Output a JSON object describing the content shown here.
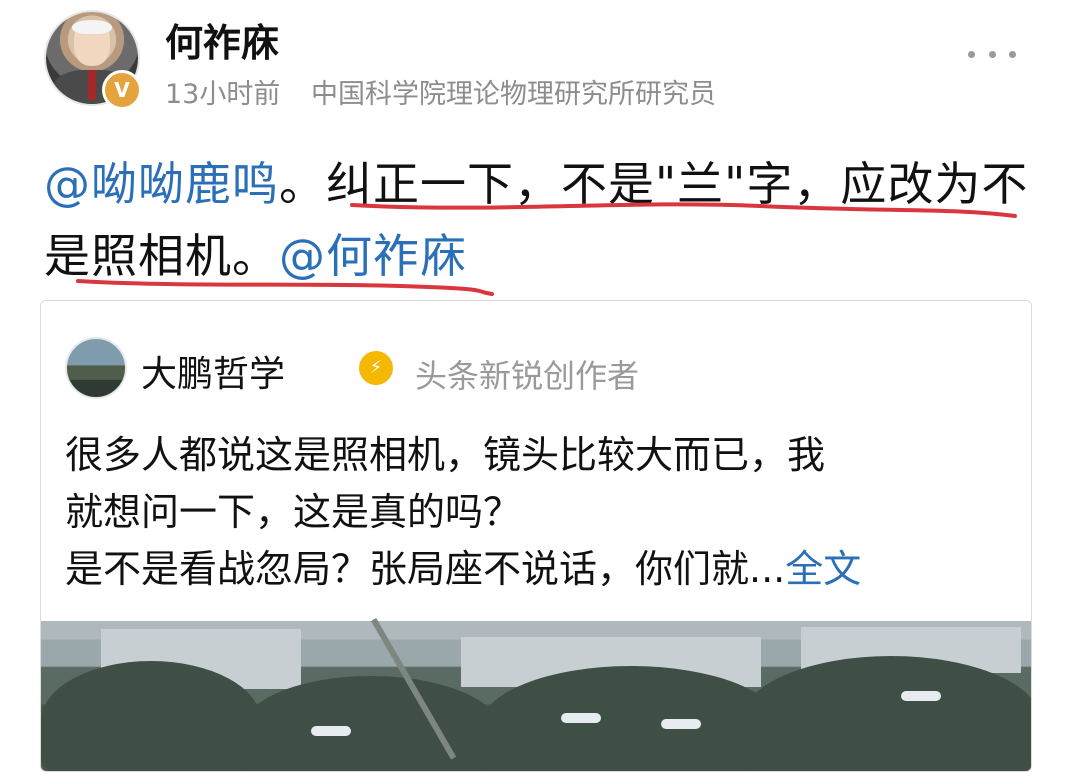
{
  "header": {
    "author_name": "何祚庥",
    "badge": "V",
    "time": "13小时前",
    "description": "中国科学院理论物理研究所研究员",
    "more_icon": "more-horizontal-icon"
  },
  "post": {
    "mention_1": "@呦呦鹿鸣",
    "text_1": "。纠正一下，不是\"兰\"字，应改为不是照相机。",
    "mention_2": "@何祚庥"
  },
  "quoted": {
    "author_name": "大鹏哲学",
    "badge_icon": "creator-badge-icon",
    "description": "头条新锐创作者",
    "text_line1": "很多人都说这是照相机，镜头比较大而已，我",
    "text_line2": "就想问一下，这是真的吗？",
    "text_line3": "是不是看战忽局？张局座不说话，你们就...",
    "more_link": "全文"
  },
  "colors": {
    "mention": "#2a6fb8",
    "underline": "#d9363e",
    "meta": "#8d8d8d"
  }
}
